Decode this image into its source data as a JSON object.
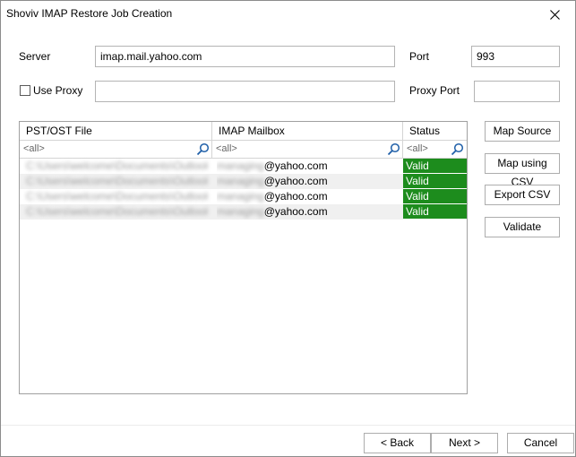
{
  "window": {
    "title": "Shoviv IMAP Restore Job Creation"
  },
  "form": {
    "server_label": "Server",
    "server_value": "imap.mail.yahoo.com",
    "port_label": "Port",
    "port_value": "993",
    "use_proxy_label": "Use Proxy",
    "proxy_value": "",
    "proxy_port_label": "Proxy Port",
    "proxy_port_value": ""
  },
  "grid": {
    "columns": [
      "PST/OST File",
      "IMAP Mailbox",
      "Status"
    ],
    "filter_placeholder": "<all>",
    "rows": [
      {
        "file": "C:\\Users\\welcome\\Documents\\Outlook ...",
        "mailbox_user": "managing",
        "mailbox_domain": "@yahoo.com",
        "status": "Valid"
      },
      {
        "file": "C:\\Users\\welcome\\Documents\\Outlook ...",
        "mailbox_user": "managing",
        "mailbox_domain": "@yahoo.com",
        "status": "Valid"
      },
      {
        "file": "C:\\Users\\welcome\\Documents\\Outlook ...",
        "mailbox_user": "managing",
        "mailbox_domain": "@yahoo.com",
        "status": "Valid"
      },
      {
        "file": "C:\\Users\\welcome\\Documents\\Outlook ...",
        "mailbox_user": "managing",
        "mailbox_domain": "@yahoo.com",
        "status": "Valid"
      }
    ]
  },
  "side_buttons": {
    "map_source": "Map Source",
    "map_csv": "Map using CSV",
    "export_csv": "Export CSV",
    "validate": "Validate"
  },
  "nav": {
    "back": "< Back",
    "next": "Next >",
    "cancel": "Cancel"
  },
  "colors": {
    "status_valid": "#1d8c1d",
    "border": "#adadad"
  },
  "icons": {
    "close": "close-icon",
    "search": "search-icon"
  }
}
